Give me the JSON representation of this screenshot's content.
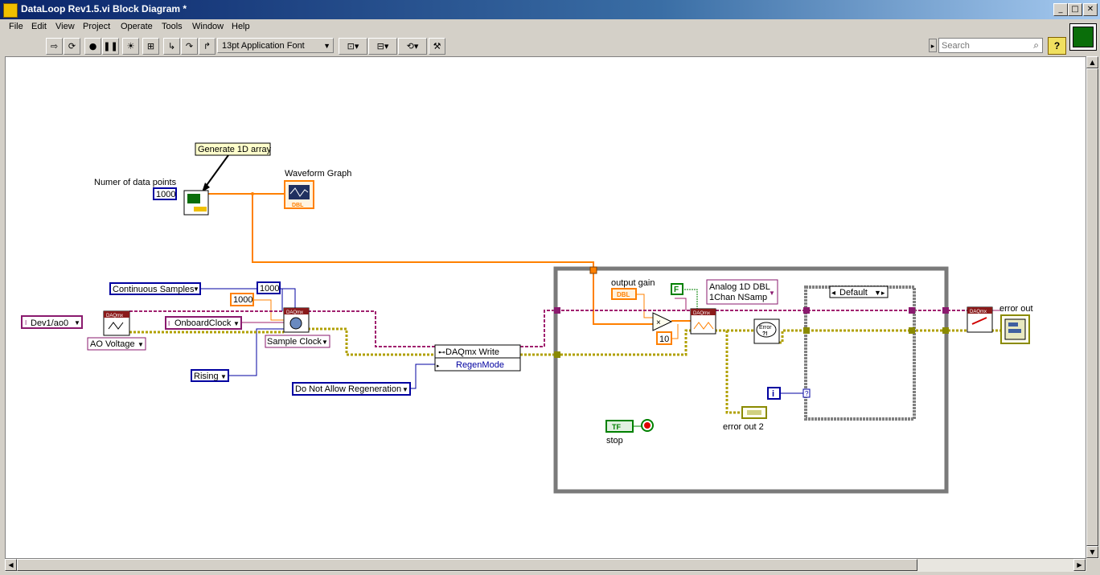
{
  "window": {
    "title": "DataLoop Rev1.5.vi Block Diagram *"
  },
  "menu": [
    "File",
    "Edit",
    "View",
    "Project",
    "Operate",
    "Tools",
    "Window",
    "Help"
  ],
  "toolbar": {
    "font": "13pt Application Font",
    "search_placeholder": "Search"
  },
  "diagram": {
    "labels": {
      "num_points": "Numer of data points",
      "waveform_graph": "Waveform Graph",
      "output_gain": "output gain",
      "stop": "stop",
      "error_out_2": "error out 2",
      "error_out": "error out",
      "regen_mode": "RegenMode",
      "daqmx_write": "DAQmx Write"
    },
    "comment": "Generate 1D array",
    "constants": {
      "n1000": "1000",
      "n1000_b": "1000",
      "n1000_orange": "1000",
      "n10": "10",
      "f_bool": "F",
      "i_iter": "i"
    },
    "enums": {
      "continuous_samples": "Continuous Samples",
      "channel": "Dev1/ao0",
      "ao_voltage": "AO Voltage",
      "onboard_clock": "OnboardClock",
      "sample_clock": "Sample Clock",
      "rising": "Rising",
      "regen": "Do Not Allow Regeneration",
      "analog_line1": "Analog 1D DBL",
      "analog_line2": "1Chan NSamp",
      "case_default": "Default"
    },
    "terminals": {
      "dbl": "DBL",
      "tf": "TF",
      "daqmx": "DAQmx"
    }
  },
  "colors": {
    "wire_orange": "#ff8000",
    "wire_pink": "#a0206e",
    "wire_blue": "#0000a0",
    "wire_error": "#b0a000",
    "loop_gray": "#7a7a7a"
  }
}
